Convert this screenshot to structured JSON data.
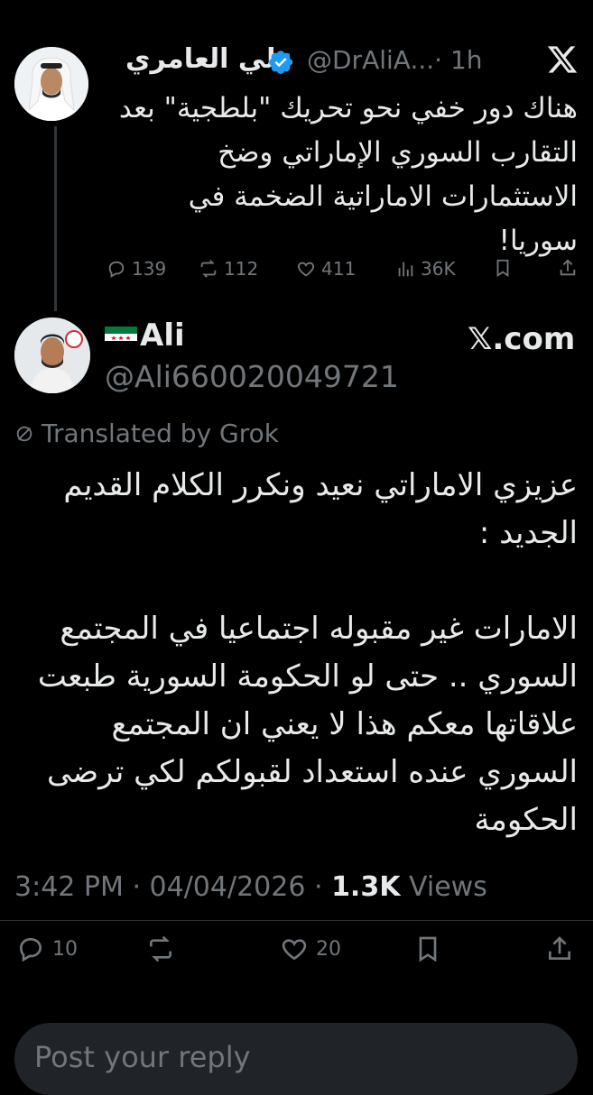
{
  "quoted": {
    "name": "علي العامري",
    "handle": "@DrAliA...",
    "time": "· 1h",
    "text": "هناك دور خفي نحو تحريك \"بلطجية\" بعد التقارب السوري الإماراتي وضخ الاستثمارات الاماراتية الضخمة في سوريا!",
    "replies": "139",
    "reposts": "112",
    "likes": "411",
    "views": "36K"
  },
  "tweet": {
    "name": "Ali",
    "handle": "@Ali660020049721",
    "source": "𝕏.com",
    "translated_label": "Translated by Grok",
    "text": "عزيزي الاماراتي نعيد ونكرر الكلام القديم الجديد :\n\nالامارات غير مقبوله اجتماعيا في المجتمع السوري .. حتى لو الحكومة السورية طبعت علاقاتها معكم هذا لا يعني ان المجتمع السوري عنده استعداد لقبولكم لكي ترضى الحكومة",
    "time": "3:42 PM",
    "date": "04/04/2026",
    "views_count": "1.3K",
    "views_label": "Views",
    "replies": "10",
    "likes": "20"
  },
  "reply_placeholder": "Post your reply",
  "colors": {
    "background": "#000000",
    "text": "#e7e9ea",
    "muted": "#71767b",
    "verified": "#1d9bf0"
  }
}
